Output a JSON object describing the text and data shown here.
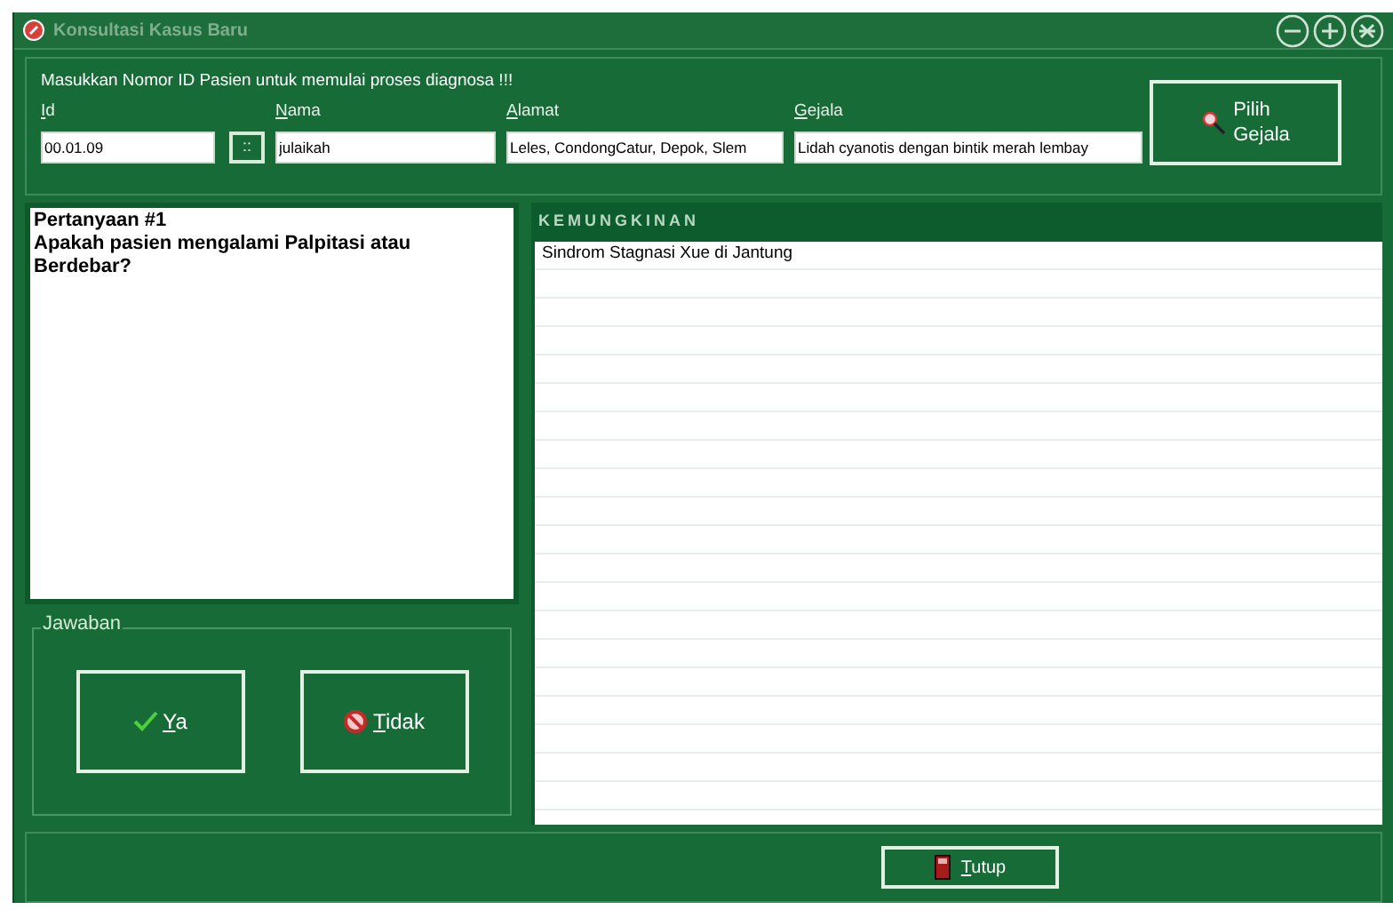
{
  "window": {
    "title": "Konsultasi Kasus Baru"
  },
  "prompt": "Masukkan Nomor ID Pasien untuk memulai proses diagnosa !!!",
  "fields": [
    {
      "label": "Id",
      "value": "00.01.09",
      "kind": "id"
    },
    {
      "label": "Nama",
      "value": "julaikah",
      "kind": "text"
    },
    {
      "label": "Alamat",
      "value": "Leles, CondongCatur, Depok, Slem",
      "kind": "text"
    },
    {
      "label": "Gejala",
      "value": "Lidah cyanotis dengan bintik merah lembay",
      "kind": "text"
    }
  ],
  "lookup_button": "::",
  "pick_button": {
    "line1": "Pilih",
    "line2": "Gejala"
  },
  "question": {
    "title": "Pertanyaan #1",
    "text": "Apakah pasien mengalami Palpitasi atau Berdebar?"
  },
  "answer": {
    "legend": "Jawaban",
    "buttons": [
      {
        "label": "Ya",
        "kind": "yes"
      },
      {
        "label": "Tidak",
        "kind": "no"
      }
    ]
  },
  "possibilities": {
    "header": "KEMUNGKINAN",
    "rows": [
      "Sindrom Stagnasi Xue di Jantung"
    ]
  },
  "close_button": "Tutup"
}
